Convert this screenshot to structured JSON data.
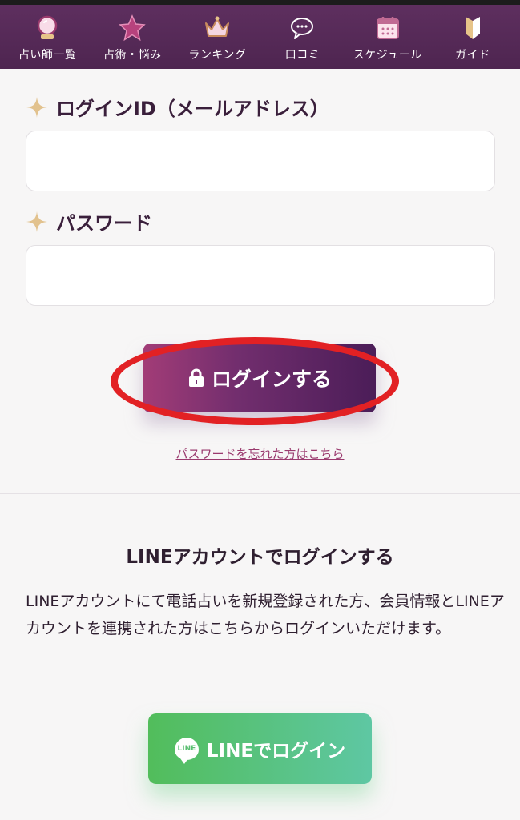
{
  "nav": [
    {
      "label": "占い師一覧",
      "icon": "crystal-ball-icon"
    },
    {
      "label": "占術・悩み",
      "icon": "star-icon"
    },
    {
      "label": "ランキング",
      "icon": "crown-icon"
    },
    {
      "label": "口コミ",
      "icon": "speech-bubble-icon"
    },
    {
      "label": "スケジュール",
      "icon": "calendar-icon"
    },
    {
      "label": "ガイド",
      "icon": "beginner-mark-icon"
    }
  ],
  "login_form": {
    "id_label": "ログインID（メールアドレス）",
    "id_value": "",
    "password_label": "パスワード",
    "password_value": "",
    "submit_label": "ログインする",
    "forgot_link": "パスワードを忘れた方はこちら"
  },
  "line_section": {
    "title": "LINEアカウントでログインする",
    "description": "LINEアカウントにて電話占いを新規登録された方、会員情報とLINEアカウントを連携された方はこちらからログインいただけます。",
    "button_label": "LINEでログイン",
    "icon_text": "LINE"
  },
  "colors": {
    "nav_bg": "#552a57",
    "accent": "#e7c489",
    "login_button": "#722e6e",
    "line_green": "#52bd5b",
    "annotation_red": "#e22124"
  }
}
